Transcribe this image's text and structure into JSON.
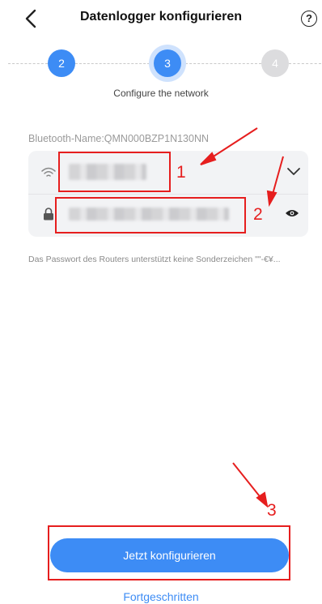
{
  "header": {
    "title": "Datenlogger konfigurieren",
    "help_label": "?"
  },
  "stepper": {
    "steps": [
      {
        "label": "2",
        "state": "done"
      },
      {
        "label": "3",
        "state": "active"
      },
      {
        "label": "4",
        "state": "todo"
      }
    ],
    "caption": "Configure the network"
  },
  "form": {
    "bluetooth_name": "Bluetooth-Name:QMN000BZP1N130NN",
    "note": "Das Passwort des Routers unterstützt keine Sonderzeichen \"\"-€¥..."
  },
  "annotations": {
    "marks": [
      "1",
      "2",
      "3"
    ]
  },
  "actions": {
    "primary_label": "Jetzt konfigurieren",
    "advanced_label": "Fortgeschritten"
  },
  "colors": {
    "accent": "#3d8cf5",
    "annotation": "#e61e1e"
  }
}
